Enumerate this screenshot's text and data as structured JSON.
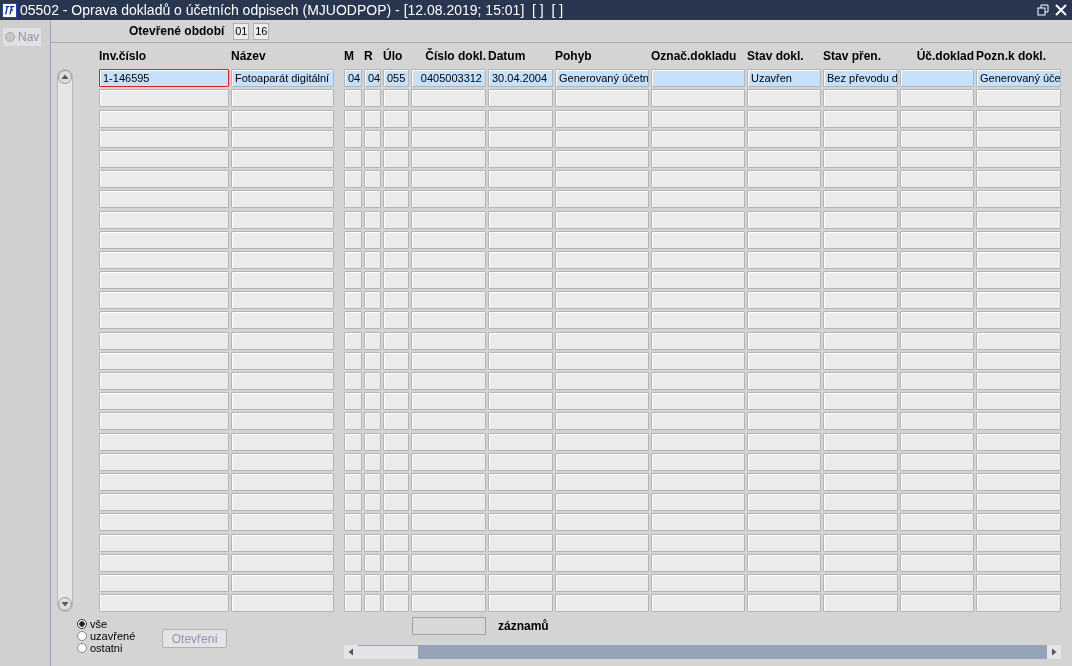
{
  "window": {
    "title": "05502 - Oprava dokladů o účetních odpisech (MJUODPOP) - [12.08.2019; 15:01]  [ ]  [ ]"
  },
  "nav": {
    "label": "Nav",
    "disabled": true
  },
  "period": {
    "label": "Otevřené období",
    "values": [
      "01",
      "16"
    ]
  },
  "table": {
    "columns": [
      {
        "label": "Inv.číslo"
      },
      {
        "label": "Název"
      },
      {
        "label": "M"
      },
      {
        "label": "R"
      },
      {
        "label": "Úlo"
      },
      {
        "label": "Číslo dokl."
      },
      {
        "label": "Datum"
      },
      {
        "label": "Pohyb"
      },
      {
        "label": "Označ.dokladu"
      },
      {
        "label": "Stav dokl."
      },
      {
        "label": "Stav přen."
      },
      {
        "label": "Úč.doklad"
      },
      {
        "label": "Pozn.k dokl."
      }
    ],
    "rows": [
      {
        "selected": true,
        "cells": [
          {
            "text": "1-146595",
            "focused": true
          },
          {
            "text": "Fotoaparát digitální",
            "focused": false
          },
          {
            "text": "04",
            "focused": false
          },
          {
            "text": "04",
            "focused": false
          },
          {
            "text": "055",
            "focused": false
          },
          {
            "text": "0405003312",
            "focused": false
          },
          {
            "text": "30.04.2004",
            "focused": false
          },
          {
            "text": "Generovaný účetn",
            "focused": false
          },
          {
            "text": "",
            "focused": false
          },
          {
            "text": "Uzavřen",
            "focused": false
          },
          {
            "text": "Bez převodu d",
            "focused": false
          },
          {
            "text": "",
            "focused": false
          },
          {
            "text": "Generovaný úče",
            "focused": false
          }
        ]
      }
    ]
  },
  "filter": [
    {
      "label": "vše",
      "selected": true
    },
    {
      "label": "uzavřené",
      "selected": false
    },
    {
      "label": "ostatni",
      "selected": false
    }
  ],
  "open_button": {
    "label": "Otevření",
    "disabled": true
  },
  "records": {
    "label": "záznamů"
  }
}
